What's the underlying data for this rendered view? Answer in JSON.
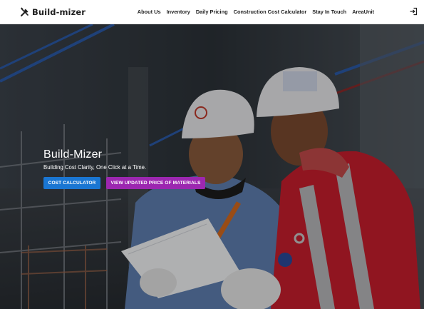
{
  "header": {
    "brand_name": "Build-mizer",
    "brand_icon": "tools-icon",
    "nav_items": [
      {
        "label": "About Us"
      },
      {
        "label": "Inventory"
      },
      {
        "label": "Daily Pricing"
      },
      {
        "label": "Construction Cost Calculator"
      },
      {
        "label": "Stay In Touch"
      },
      {
        "label": "AreaUnit"
      }
    ],
    "login_icon": "login-icon"
  },
  "hero": {
    "title": "Build-Mizer",
    "subtitle": "Building Cost Clarity, One Click at a Time.",
    "primary_button": "COST CALCULATOR",
    "secondary_button": "VIEW UPDATED PRICE OF MATERIALS",
    "image": "construction-workers-reviewing-plans-photo"
  },
  "colors": {
    "primary": "#1a76d2",
    "secondary": "#9c27b0",
    "navbar_bg": "#ffffff",
    "text_dark": "#1f1f1f"
  }
}
